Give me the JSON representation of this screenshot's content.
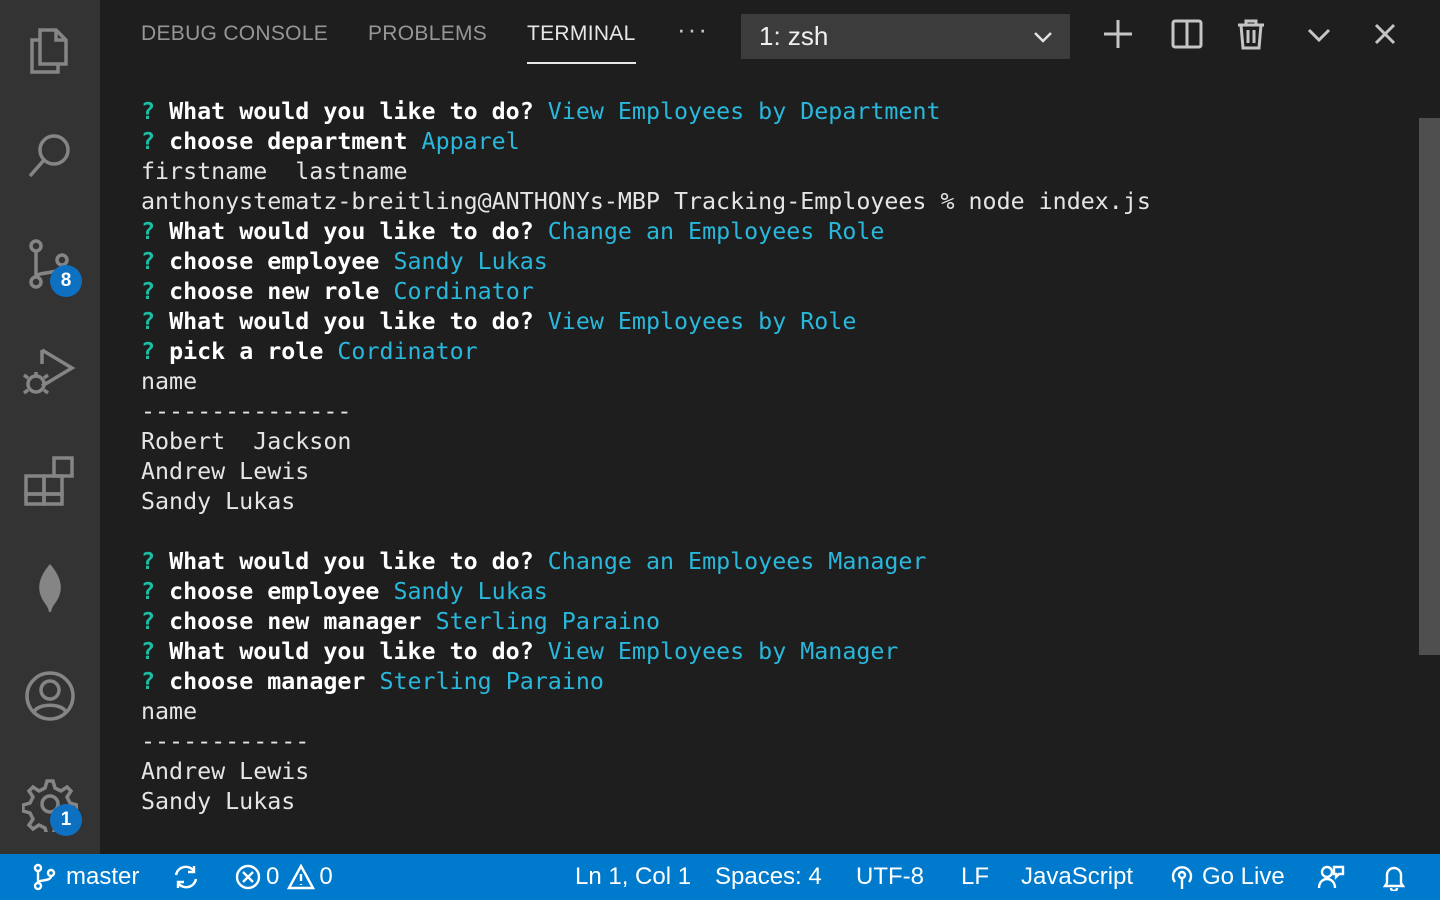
{
  "activity_bar": {
    "source_control_badge": "8",
    "settings_badge": "1"
  },
  "panel": {
    "tabs": [
      {
        "label": "DEBUG CONSOLE"
      },
      {
        "label": "PROBLEMS"
      },
      {
        "label": "TERMINAL"
      }
    ],
    "more_label": "···",
    "terminal_select": "1: zsh"
  },
  "terminal": {
    "lines": [
      {
        "q": "?",
        "prompt": "What would you like to do?",
        "answer": "View Employees by Department",
        "text": ""
      },
      {
        "q": "?",
        "prompt": "choose department",
        "answer": "Apparel",
        "text": ""
      },
      {
        "q": "",
        "prompt": "",
        "answer": "",
        "text": "firstname  lastname"
      },
      {
        "q": "",
        "prompt": "",
        "answer": "",
        "text": "anthonystematz-breitling@ANTHONYs-MBP Tracking-Employees % node index.js"
      },
      {
        "q": "?",
        "prompt": "What would you like to do?",
        "answer": "Change an Employees Role",
        "text": ""
      },
      {
        "q": "?",
        "prompt": "choose employee",
        "answer": "Sandy Lukas",
        "text": ""
      },
      {
        "q": "?",
        "prompt": "choose new role",
        "answer": "Cordinator",
        "text": ""
      },
      {
        "q": "?",
        "prompt": "What would you like to do?",
        "answer": "View Employees by Role",
        "text": ""
      },
      {
        "q": "?",
        "prompt": "pick a role",
        "answer": "Cordinator",
        "text": ""
      },
      {
        "q": "",
        "prompt": "",
        "answer": "",
        "text": "name"
      },
      {
        "q": "",
        "prompt": "",
        "answer": "",
        "text": "---------------"
      },
      {
        "q": "",
        "prompt": "",
        "answer": "",
        "text": "Robert  Jackson"
      },
      {
        "q": "",
        "prompt": "",
        "answer": "",
        "text": "Andrew Lewis"
      },
      {
        "q": "",
        "prompt": "",
        "answer": "",
        "text": "Sandy Lukas"
      },
      {
        "q": "",
        "prompt": "",
        "answer": "",
        "text": ""
      },
      {
        "q": "?",
        "prompt": "What would you like to do?",
        "answer": "Change an Employees Manager",
        "text": ""
      },
      {
        "q": "?",
        "prompt": "choose employee",
        "answer": "Sandy Lukas",
        "text": ""
      },
      {
        "q": "?",
        "prompt": "choose new manager",
        "answer": "Sterling Paraino",
        "text": ""
      },
      {
        "q": "?",
        "prompt": "What would you like to do?",
        "answer": "View Employees by Manager",
        "text": ""
      },
      {
        "q": "?",
        "prompt": "choose manager",
        "answer": "Sterling Paraino",
        "text": ""
      },
      {
        "q": "",
        "prompt": "",
        "answer": "",
        "text": "name"
      },
      {
        "q": "",
        "prompt": "",
        "answer": "",
        "text": "------------"
      },
      {
        "q": "",
        "prompt": "",
        "answer": "",
        "text": "Andrew Lewis"
      },
      {
        "q": "",
        "prompt": "",
        "answer": "",
        "text": "Sandy Lukas"
      }
    ]
  },
  "status_bar": {
    "branch": "master",
    "errors": "0",
    "warnings": "0",
    "cursor": "Ln 1, Col 1",
    "spaces": "Spaces: 4",
    "encoding": "UTF-8",
    "eol": "LF",
    "language": "JavaScript",
    "go_live": "Go Live"
  },
  "colors": {
    "status_bar_bg": "#007acc",
    "activity_bar_bg": "#333333",
    "terminal_bg": "#1e1e1e",
    "answer_cyan": "#29b8db",
    "question_green": "#1cbda4",
    "badge_blue": "#0e70c0"
  },
  "icons": [
    "files-icon",
    "search-icon",
    "source-control-icon",
    "run-debug-icon",
    "extensions-icon",
    "mongodb-leaf-icon",
    "account-icon",
    "settings-gear-icon",
    "new-terminal-icon",
    "split-terminal-icon",
    "trash-icon",
    "maximize-chevron-icon",
    "close-icon",
    "git-branch-icon",
    "sync-icon",
    "error-icon",
    "warning-icon",
    "broadcast-icon",
    "feedback-icon",
    "bell-icon"
  ]
}
